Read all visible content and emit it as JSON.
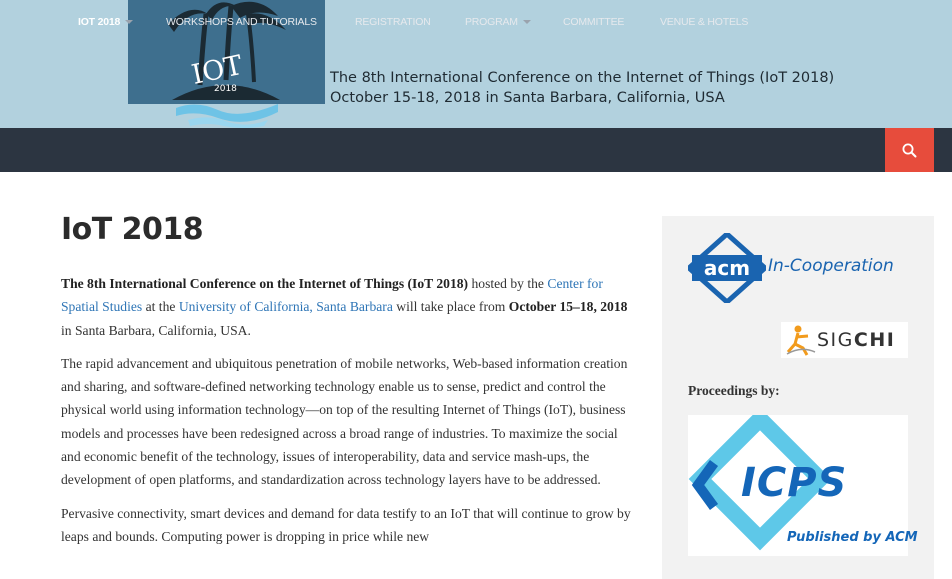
{
  "header": {
    "logo_text": "IOT",
    "logo_year": "2018",
    "title_line1": "The 8th International Conference on the Internet of Things (IoT 2018)",
    "title_line2": "October 15-18, 2018 in Santa Barbara, California, USA",
    "header_bg": "#b2d1de",
    "logo_bg": "#3e6f8e"
  },
  "nav": {
    "items": [
      {
        "label": "IOT 2018",
        "has_dropdown": true,
        "active": true
      },
      {
        "label": "WORKSHOPS AND TUTORIALS",
        "has_dropdown": false
      },
      {
        "label": "REGISTRATION",
        "has_dropdown": false
      },
      {
        "label": "PROGRAM",
        "has_dropdown": true
      },
      {
        "label": "COMMITTEE",
        "has_dropdown": false
      },
      {
        "label": "VENUE & HOTELS",
        "has_dropdown": false
      }
    ],
    "search_icon": "search-icon",
    "bg": "#2c3541",
    "search_bg": "#e74c3c"
  },
  "main": {
    "title": "IoT 2018",
    "intro": {
      "bold1": "The 8th International Conference on the Internet of Things (IoT 2018)",
      "t1": " hosted by the ",
      "link1": "Center for Spatial Studies",
      "t2": " at the ",
      "link2": "University of California, Santa Barbara",
      "t3": " will take place from ",
      "bold2": "October 15–18, 2018",
      "t4": " in Santa Barbara, California, USA."
    },
    "para2": "The rapid advancement and ubiquitous penetration of mobile networks, Web-based information creation and sharing, and software-defined networking technology enable us to sense, predict and control the physical world using information technology—on top of the resulting Internet of Things (IoT), business models and processes have been redesigned across a broad range of industries. To maximize the social and economic benefit of the technology, issues of interoperability, data and service mash-ups, the development of open platforms, and standardization across technology layers have to be addressed.",
    "para3": "Pervasive connectivity, smart devices and demand for data testify to an IoT that will continue to grow by leaps and bounds. Computing power is dropping in price while new"
  },
  "sidebar": {
    "acm_mark": "acm",
    "acm_text": "In-Cooperation",
    "sigchi_pre": "SIG",
    "sigchi_bold": "CHI",
    "proceedings_label": "Proceedings by:",
    "icps_text": "ICPS",
    "icps_published": "Published by ACM"
  }
}
